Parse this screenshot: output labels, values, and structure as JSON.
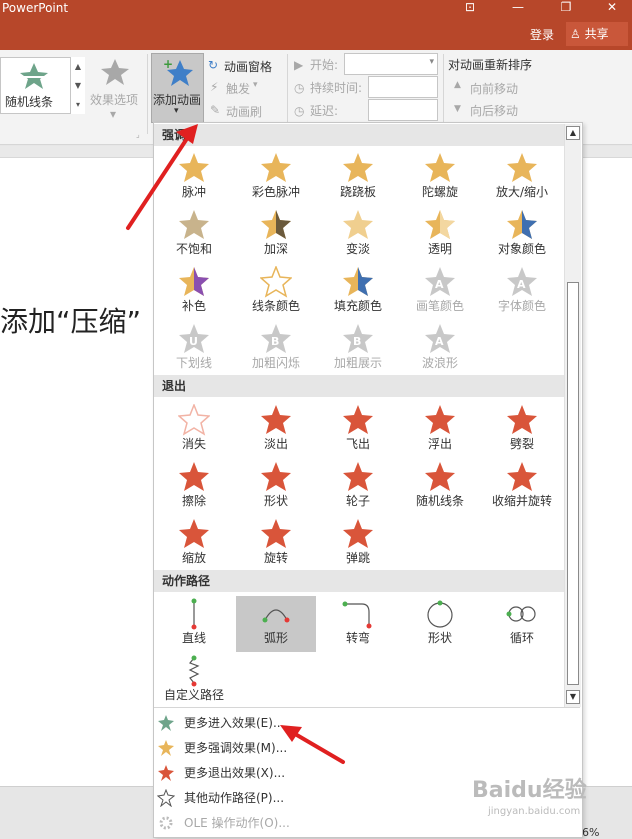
{
  "app_title": "PowerPoint",
  "titlebar": {
    "login": "登录",
    "share": "共享"
  },
  "ribbon": {
    "gallery_selected": "随机线条",
    "effect_options": "效果选项",
    "add_animation": "添加动画",
    "animation_pane": "动画窗格",
    "trigger": "触发",
    "animation_painter": "动画刷",
    "start_label": "开始:",
    "duration_label": "持续时间:",
    "delay_label": "延迟:",
    "reorder_title": "对动画重新排序",
    "move_earlier": "向前移动",
    "move_later": "向后移动"
  },
  "slide": {
    "text": "添加“压缩”"
  },
  "dropdown": {
    "sections": {
      "emphasis": "强调",
      "exit": "退出",
      "motion": "动作路径"
    },
    "emphasis_items": [
      "脉冲",
      "彩色脉冲",
      "跷跷板",
      "陀螺旋",
      "放大/缩小",
      "不饱和",
      "加深",
      "变淡",
      "透明",
      "对象颜色",
      "补色",
      "线条颜色",
      "填充颜色",
      "画笔颜色",
      "字体颜色",
      "下划线",
      "加粗闪烁",
      "加粗展示",
      "波浪形"
    ],
    "exit_items": [
      "消失",
      "淡出",
      "飞出",
      "浮出",
      "劈裂",
      "擦除",
      "形状",
      "轮子",
      "随机线条",
      "收缩并旋转",
      "缩放",
      "旋转",
      "弹跳"
    ],
    "motion_items": [
      "直线",
      "弧形",
      "转弯",
      "形状",
      "循环",
      "自定义路径"
    ],
    "menu_items": [
      "更多进入效果(E)...",
      "更多强调效果(M)...",
      "更多退出效果(X)...",
      "其他动作路径(P)...",
      "OLE 操作动作(O)..."
    ]
  },
  "status": {
    "zoom": "6%"
  },
  "watermark": {
    "logo": "Baidu经验",
    "url": "jingyan.baidu.com"
  },
  "colors": {
    "title_bar": "#b7472a",
    "emphasis_star": "#e8b55a",
    "exit_star": "#d9553a",
    "entrance_star": "#6ea48a",
    "arrow": "#e02020"
  }
}
